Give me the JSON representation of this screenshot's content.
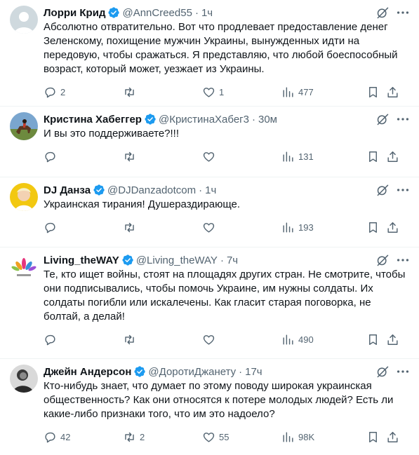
{
  "colors": {
    "verified": "#1d9bf0",
    "text": "#0f1419",
    "muted": "#536471",
    "divider": "#eff3f4"
  },
  "tweets": [
    {
      "name": "Лорри Крид",
      "handle": "@AnnCreed55",
      "sep": "·",
      "time": "1ч",
      "text": "Абсолютно отвратительно. Вот что продлевает предоставление денег Зеленскому, похищение мужчин Украины, вынужденных идти на передовую, чтобы сражаться. Я представляю, что любой боеспособный возраст, который может, уезжает из Украины.",
      "replies": "2",
      "retweets": "",
      "likes": "1",
      "views": "477",
      "avatar": "default-avatar"
    },
    {
      "name": "Кристина Хабеггер",
      "handle": "@КристинаХабег3",
      "sep": "·",
      "time": "30м",
      "text": "И вы это поддерживаете?!!!",
      "replies": "",
      "retweets": "",
      "likes": "",
      "views": "131",
      "avatar": "horse-rider-avatar"
    },
    {
      "name": "DJ Данза",
      "handle": "@DJDanzadotcom",
      "sep": "·",
      "time": "1ч",
      "text": "Украинская тирания! Душераздирающе.",
      "replies": "",
      "retweets": "",
      "likes": "",
      "views": "193",
      "avatar": "blonde-person-avatar"
    },
    {
      "name": "Living_theWAY",
      "handle": "@Living_theWAY",
      "sep": "·",
      "time": "7ч",
      "text": "Те, кто ищет войны, стоят на площадях других стран. Не смотрите, чтобы они подписывались, чтобы помочь Украине, им нужны солдаты. Их солдаты погибли или искалечены. Как гласит старая поговорка, не болтай, а делай!",
      "replies": "",
      "retweets": "",
      "likes": "",
      "views": "490",
      "avatar": "lotus-logo-avatar"
    },
    {
      "name": "Джейн Андерсон",
      "handle": "@ДоротиДжанету",
      "sep": "·",
      "time": "17ч",
      "text": "Кто-нибудь знает, что думает по этому поводу широкая украинская общественность? Как они относятся к потере молодых людей? Есть ли какие-либо признаки того, что им это надоело?",
      "replies": "42",
      "retweets": "2",
      "likes": "55",
      "views": "98K",
      "avatar": "dark-photo-avatar"
    }
  ]
}
